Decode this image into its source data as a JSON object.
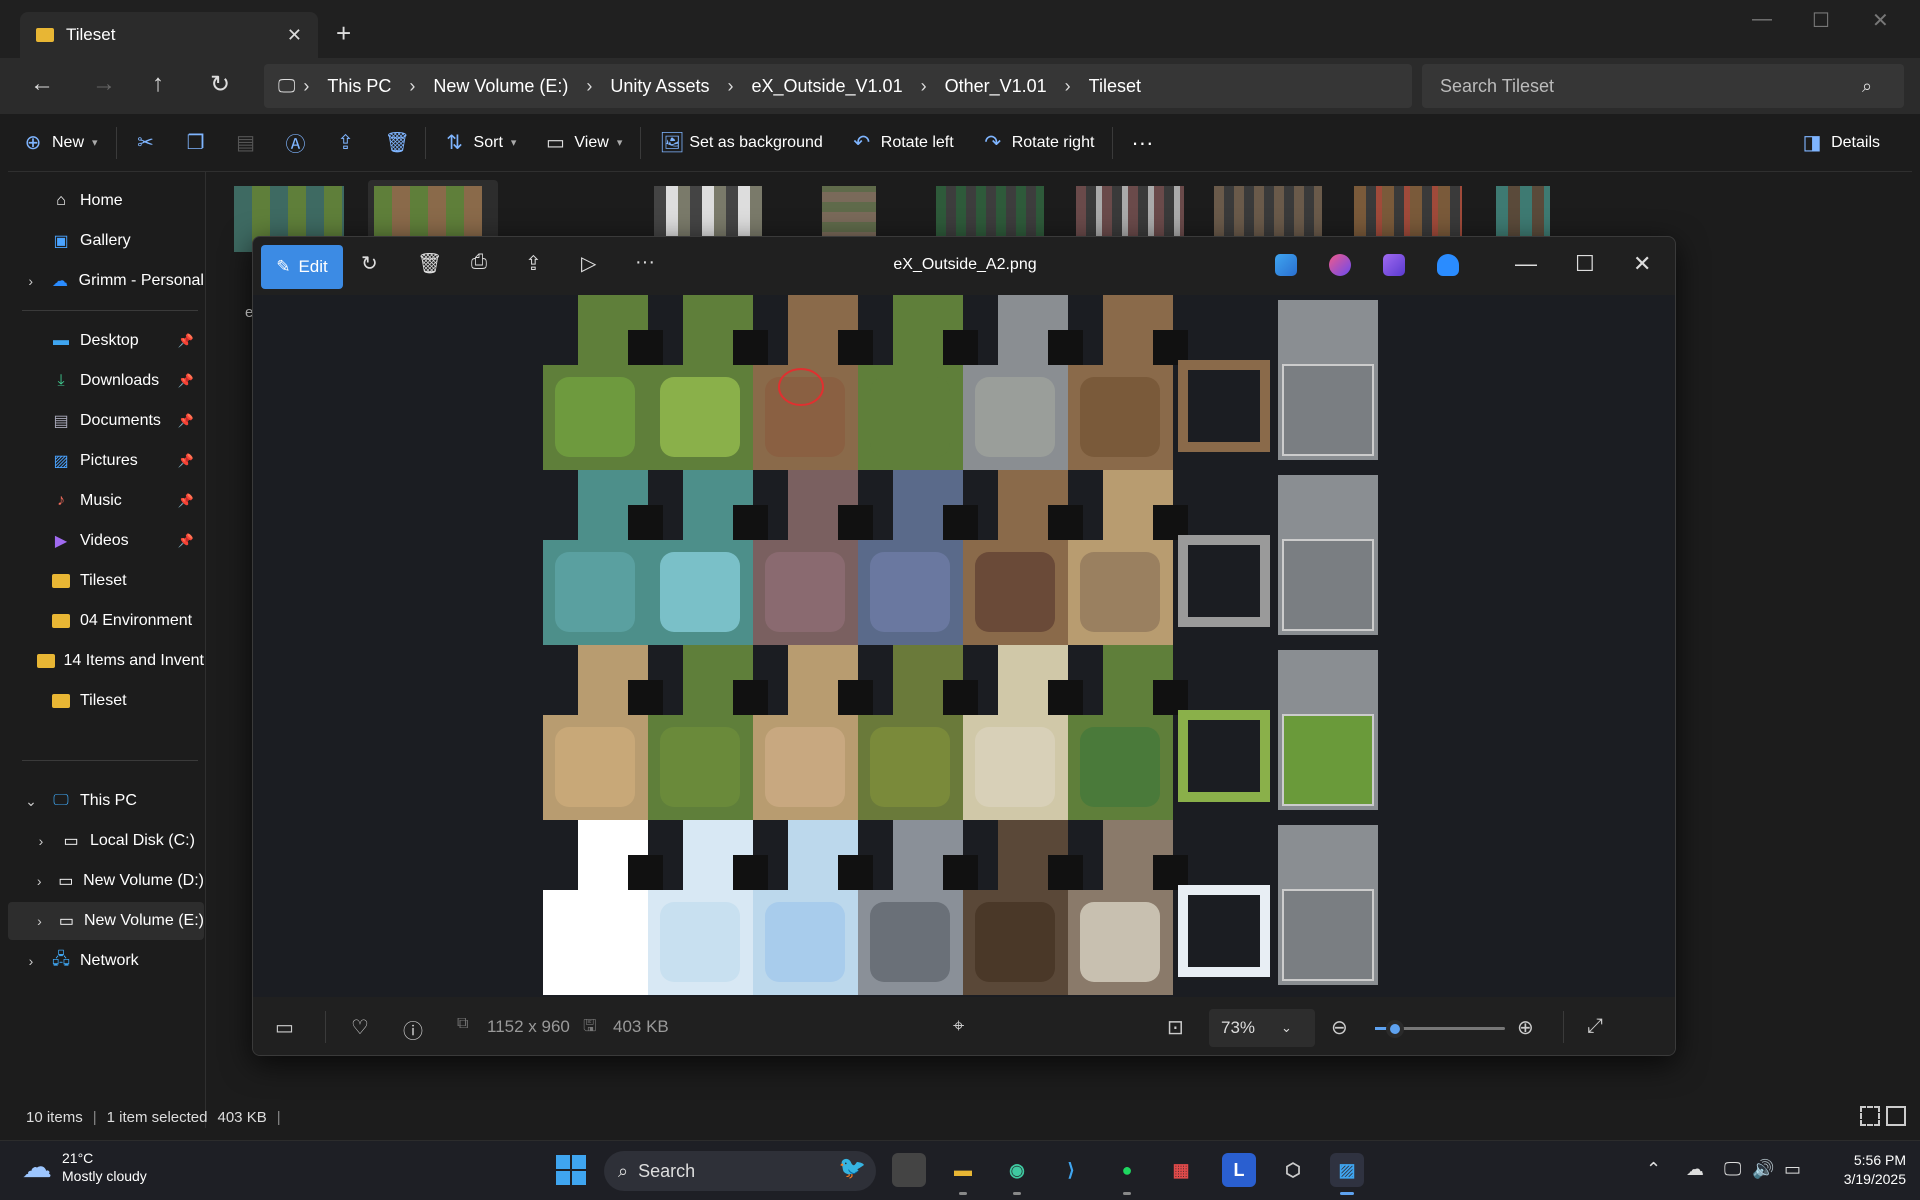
{
  "explorer": {
    "tab": {
      "label": "Tileset"
    },
    "breadcrumb": [
      "This PC",
      "New Volume (E:)",
      "Unity Assets",
      "eX_Outside_V1.01",
      "Other_V1.01",
      "Tileset"
    ],
    "search_placeholder": "Search Tileset",
    "toolbar": {
      "new": "New",
      "sort": "Sort",
      "view": "View",
      "set_background": "Set as background",
      "rotate_left": "Rotate left",
      "rotate_right": "Rotate right",
      "details": "Details"
    },
    "nav": {
      "home": "Home",
      "gallery": "Gallery",
      "onedrive": "Grimm - Personal",
      "desktop": "Desktop",
      "downloads": "Downloads",
      "documents": "Documents",
      "pictures": "Pictures",
      "music": "Music",
      "videos": "Videos",
      "folder1": "Tileset",
      "folder2": "04 Environment",
      "folder3": "14 Items and Invent",
      "folder4": "Tileset",
      "this_pc": "This PC",
      "disk_c": "Local Disk (C:)",
      "disk_d": "New Volume (D:)",
      "disk_e": "New Volume (E:)",
      "network": "Network"
    },
    "first_item_label": "e",
    "status": {
      "items": "10 items",
      "selected": "1 item selected",
      "size": "403 KB"
    }
  },
  "photos": {
    "edit_label": "Edit",
    "title": "eX_Outside_A2.png",
    "dimensions": "1152 x 960",
    "file_size": "403 KB",
    "zoom": "73%",
    "zoom_slider_fraction": 0.15
  },
  "taskbar": {
    "weather_temp": "21°C",
    "weather_desc": "Mostly cloudy",
    "search_label": "Search",
    "time": "5:56 PM",
    "date": "3/19/2025"
  },
  "colors": {
    "accent": "#3c8be4",
    "folder": "#e8b634",
    "grass": "#5f7f3a",
    "dirt": "#8a6a4a",
    "water": "#4d8f8a",
    "stone": "#8a8e92",
    "sand": "#b89c70",
    "snow": "#d8e8f4"
  }
}
